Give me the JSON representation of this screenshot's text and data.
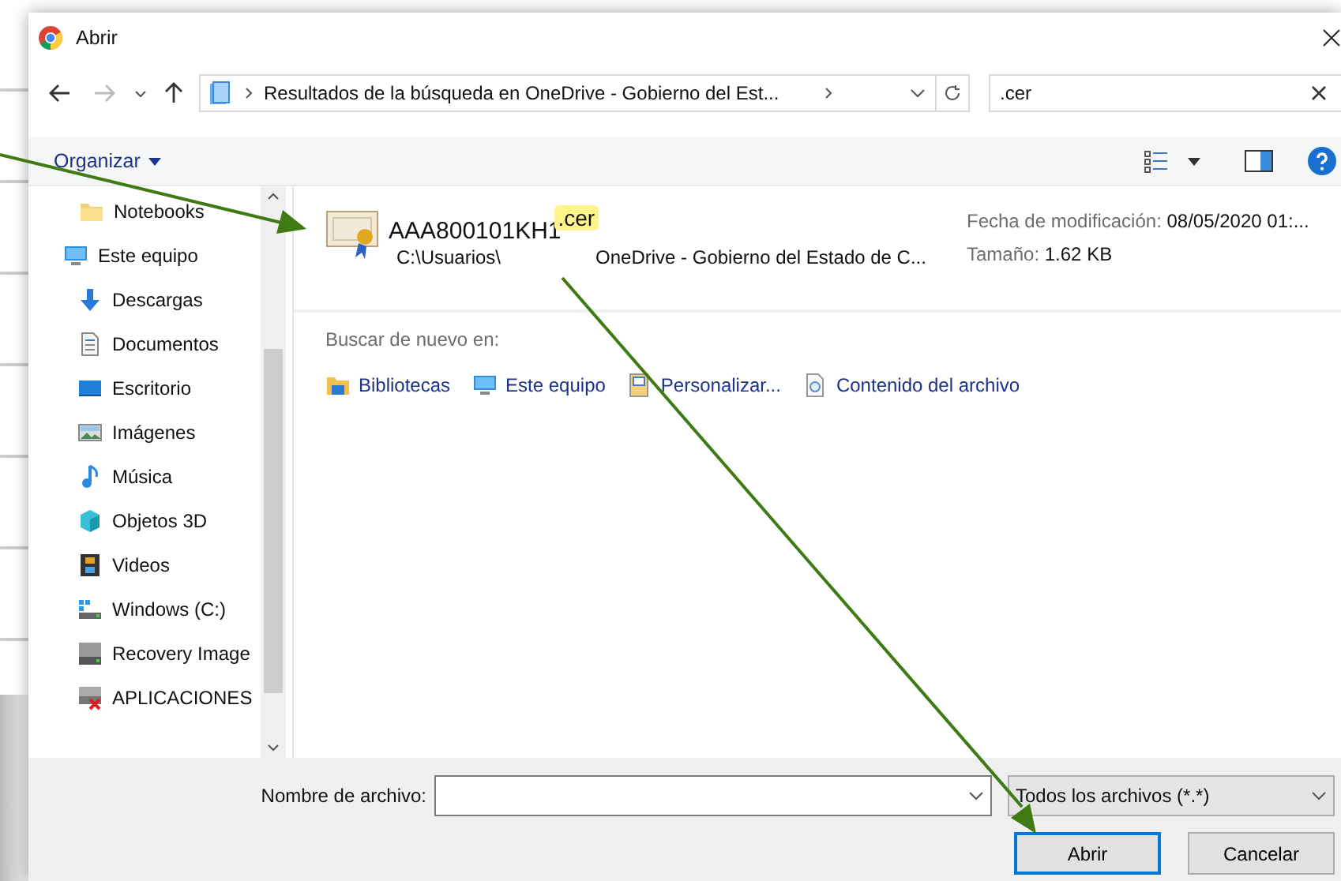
{
  "window": {
    "title": "Abrir"
  },
  "address": {
    "path": "Resultados de la búsqueda en OneDrive - Gobierno del Est..."
  },
  "search": {
    "value": ".cer"
  },
  "toolbar": {
    "organize": "Organizar"
  },
  "sidebar": {
    "items": [
      {
        "label": "Notebooks",
        "kind": "folder"
      },
      {
        "label": "Este equipo",
        "kind": "pc",
        "children": [
          {
            "label": "Descargas",
            "kind": "download"
          },
          {
            "label": "Documentos",
            "kind": "documents"
          },
          {
            "label": "Escritorio",
            "kind": "desktop"
          },
          {
            "label": "Imágenes",
            "kind": "pictures"
          },
          {
            "label": "Música",
            "kind": "music"
          },
          {
            "label": "Objetos 3D",
            "kind": "objects3d"
          },
          {
            "label": "Videos",
            "kind": "videos"
          },
          {
            "label": "Windows (C:)",
            "kind": "windrive"
          },
          {
            "label": "Recovery Image",
            "kind": "drive"
          },
          {
            "label": "APLICACIONES",
            "kind": "netdrive"
          }
        ]
      }
    ]
  },
  "results": [
    {
      "name": "AAA800101KH1",
      "highlight": ".cer",
      "path_start": "C:\\Usuarios\\",
      "path_end": "OneDrive - Gobierno del Estado de C...",
      "modified_label": "Fecha de modificación:",
      "modified": "08/05/2020 01:...",
      "size_label": "Tamaño:",
      "size": "1.62 KB"
    }
  ],
  "search_again": {
    "label": "Buscar de nuevo en:",
    "locations": [
      {
        "kind": "libraries",
        "label": "Bibliotecas"
      },
      {
        "kind": "pc",
        "label": "Este equipo"
      },
      {
        "kind": "custom",
        "label": "Personalizar..."
      },
      {
        "kind": "content",
        "label": "Contenido del archivo"
      }
    ]
  },
  "footer": {
    "filename_label": "Nombre de archivo:",
    "filter": "Todos los archivos (*.*)",
    "buttons": [
      {
        "label": "Abrir",
        "default": true
      },
      {
        "label": "Cancelar",
        "default": false
      }
    ]
  }
}
